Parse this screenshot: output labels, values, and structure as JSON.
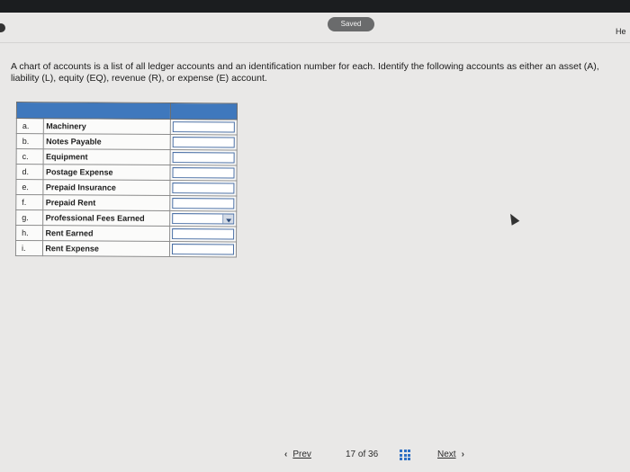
{
  "status": {
    "saved_label": "Saved"
  },
  "header": {
    "help_label": "He"
  },
  "question": {
    "text": "A chart of accounts is a list of all ledger accounts and an identification number for each. Identify the following accounts as either an asset (A), liability (L), equity (EQ), revenue (R), or expense (E) account."
  },
  "accounts": [
    {
      "letter": "a.",
      "name": "Machinery",
      "answer": ""
    },
    {
      "letter": "b.",
      "name": "Notes Payable",
      "answer": ""
    },
    {
      "letter": "c.",
      "name": "Equipment",
      "answer": ""
    },
    {
      "letter": "d.",
      "name": "Postage Expense",
      "answer": ""
    },
    {
      "letter": "e.",
      "name": "Prepaid Insurance",
      "answer": ""
    },
    {
      "letter": "f.",
      "name": "Prepaid Rent",
      "answer": ""
    },
    {
      "letter": "g.",
      "name": "Professional Fees Earned",
      "answer": ""
    },
    {
      "letter": "h.",
      "name": "Rent Earned",
      "answer": ""
    },
    {
      "letter": "i.",
      "name": "Rent Expense",
      "answer": ""
    }
  ],
  "pagination": {
    "prev_label": "Prev",
    "prev_icon": "chevron-left-icon",
    "current": "17",
    "of_label": "of",
    "total": "36",
    "grid_icon": "grid-icon",
    "next_label": "Next",
    "next_icon": "chevron-right-icon"
  },
  "colors": {
    "table_header": "#3f78bd",
    "grid_icon": "#2e6fc4"
  }
}
